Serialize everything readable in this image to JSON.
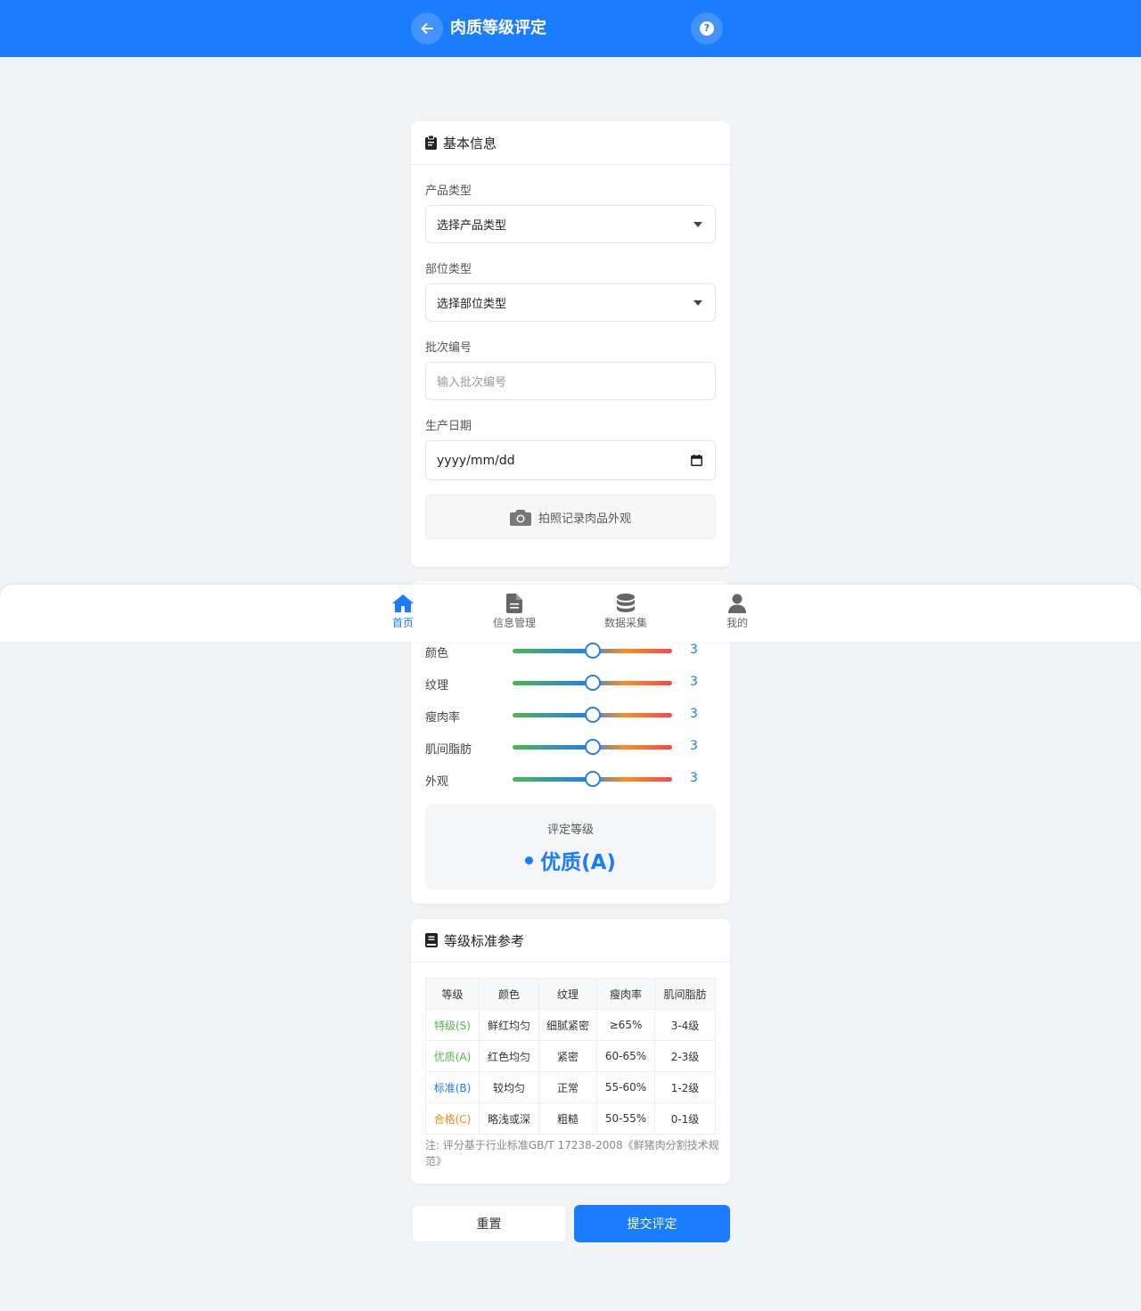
{
  "header": {
    "title": "肉质等级评定"
  },
  "basic_info": {
    "title": "基本信息",
    "product_type": {
      "label": "产品类型",
      "value": "选择产品类型"
    },
    "part_type": {
      "label": "部位类型",
      "value": "选择部位类型"
    },
    "batch_no": {
      "label": "批次编号",
      "placeholder": "输入批次编号"
    },
    "prod_date": {
      "label": "生产日期",
      "value": "yyyy/mm/dd"
    },
    "photo_button": "拍照记录肉品外观"
  },
  "scoring": {
    "sliders": [
      {
        "label": "颜色",
        "value": "3",
        "level": 0.5
      },
      {
        "label": "纹理",
        "value": "3",
        "level": 0.5
      },
      {
        "label": "瘦肉率",
        "value": "3",
        "level": 0.5
      },
      {
        "label": "肌间脂肪",
        "value": "3",
        "level": 0.5
      },
      {
        "label": "外观",
        "value": "3",
        "level": 0.5
      }
    ],
    "grade_title": "评定等级",
    "grade_value": "优质(A)"
  },
  "standards": {
    "title": "等级标准参考",
    "headers": [
      "等级",
      "颜色",
      "纹理",
      "瘦肉率",
      "肌间脂肪"
    ],
    "rows": [
      {
        "grade": "特级(S)",
        "color": "#52b84a",
        "cells": [
          "鲜红均匀",
          "细腻紧密",
          "≥65%",
          "3-4级"
        ]
      },
      {
        "grade": "优质(A)",
        "color": "#52b84a",
        "cells": [
          "红色均匀",
          "紧密",
          "60-65%",
          "2-3级"
        ]
      },
      {
        "grade": "标准(B)",
        "color": "#1a7cff",
        "cells": [
          "较均匀",
          "正常",
          "55-60%",
          "1-2级"
        ]
      },
      {
        "grade": "合格(C)",
        "color": "#f08a1c",
        "cells": [
          "略浅或深",
          "粗糙",
          "50-55%",
          "0-1级"
        ]
      }
    ],
    "note": "注: 评分基于行业标准GB/T 17238-2008《鲜猪肉分割技术规范》"
  },
  "actions": {
    "reset": "重置",
    "submit": "提交评定"
  },
  "nav": [
    {
      "label": "首页",
      "icon": "home-icon",
      "active": true
    },
    {
      "label": "信息管理",
      "icon": "file-icon",
      "active": false
    },
    {
      "label": "数据采集",
      "icon": "database-icon",
      "active": false
    },
    {
      "label": "我的",
      "icon": "user-icon",
      "active": false
    }
  ],
  "colors": {
    "primary": "#1a7cff",
    "background": "#f2f3f5"
  }
}
